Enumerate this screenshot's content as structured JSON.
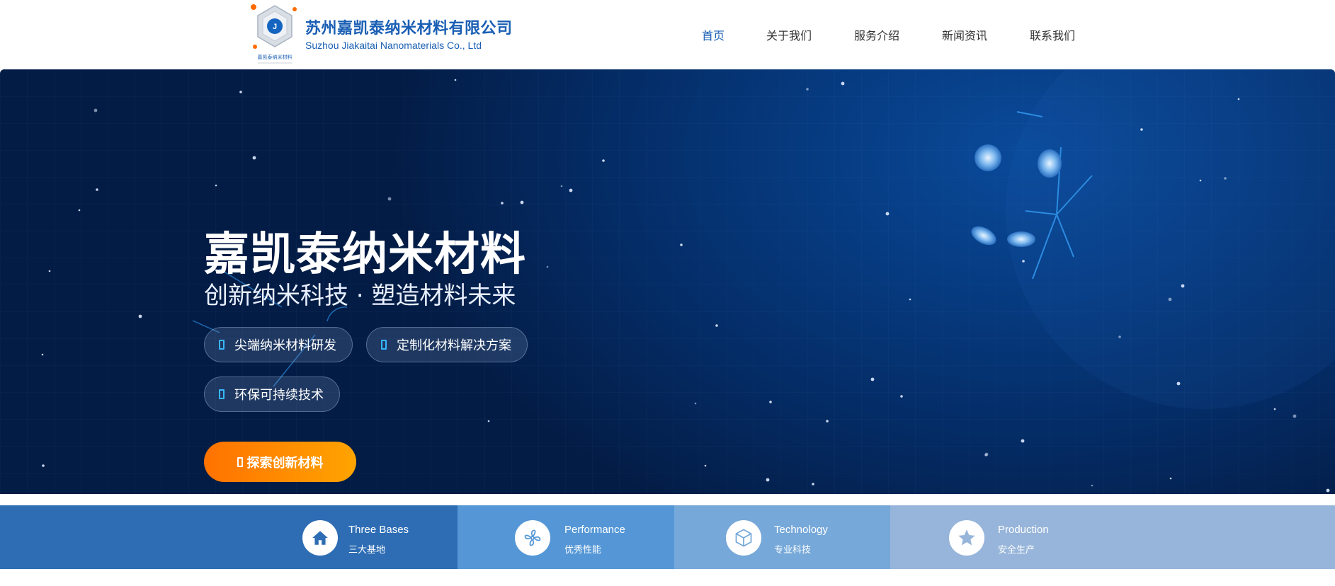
{
  "header": {
    "company_name_cn": "苏州嘉凯泰纳米材料有限公司",
    "company_name_en": "Suzhou Jiakaitai Nanomaterials Co., Ltd",
    "logo_caption": "嘉凯泰纳米材料",
    "logo_letter": "J"
  },
  "nav": {
    "items": [
      {
        "label": "首页",
        "active": true
      },
      {
        "label": "关于我们",
        "active": false
      },
      {
        "label": "服务介绍",
        "active": false
      },
      {
        "label": "新闻资讯",
        "active": false
      },
      {
        "label": "联系我们",
        "active": false
      }
    ]
  },
  "hero": {
    "title": "嘉凯泰纳米材料",
    "subtitle": "创新纳米科技 · 塑造材料未来",
    "tags": [
      {
        "label": "尖端纳米材料研发",
        "icon": "tag-icon"
      },
      {
        "label": "定制化材料解决方案",
        "icon": "tag-icon"
      },
      {
        "label": "环保可持续技术",
        "icon": "tag-icon"
      }
    ],
    "cta_label": "探索创新材料"
  },
  "features": [
    {
      "title_en": "Three Bases",
      "title_cn": "三大基地",
      "icon": "home-icon",
      "color": "#2e6db4"
    },
    {
      "title_en": "Performance",
      "title_cn": "优秀性能",
      "icon": "fan-icon",
      "color": "#5597d6"
    },
    {
      "title_en": "Technology",
      "title_cn": "专业科技",
      "icon": "cube-icon",
      "color": "#76a8d9"
    },
    {
      "title_en": "Production",
      "title_cn": "安全生产",
      "icon": "star-icon",
      "color": "#97b5da"
    }
  ],
  "colors": {
    "brand_blue": "#1a5fb4",
    "hero_bg": "#042a62",
    "cta_orange_start": "#ff7200",
    "cta_orange_end": "#ffa400",
    "tag_icon_cyan": "#38b6ff"
  }
}
